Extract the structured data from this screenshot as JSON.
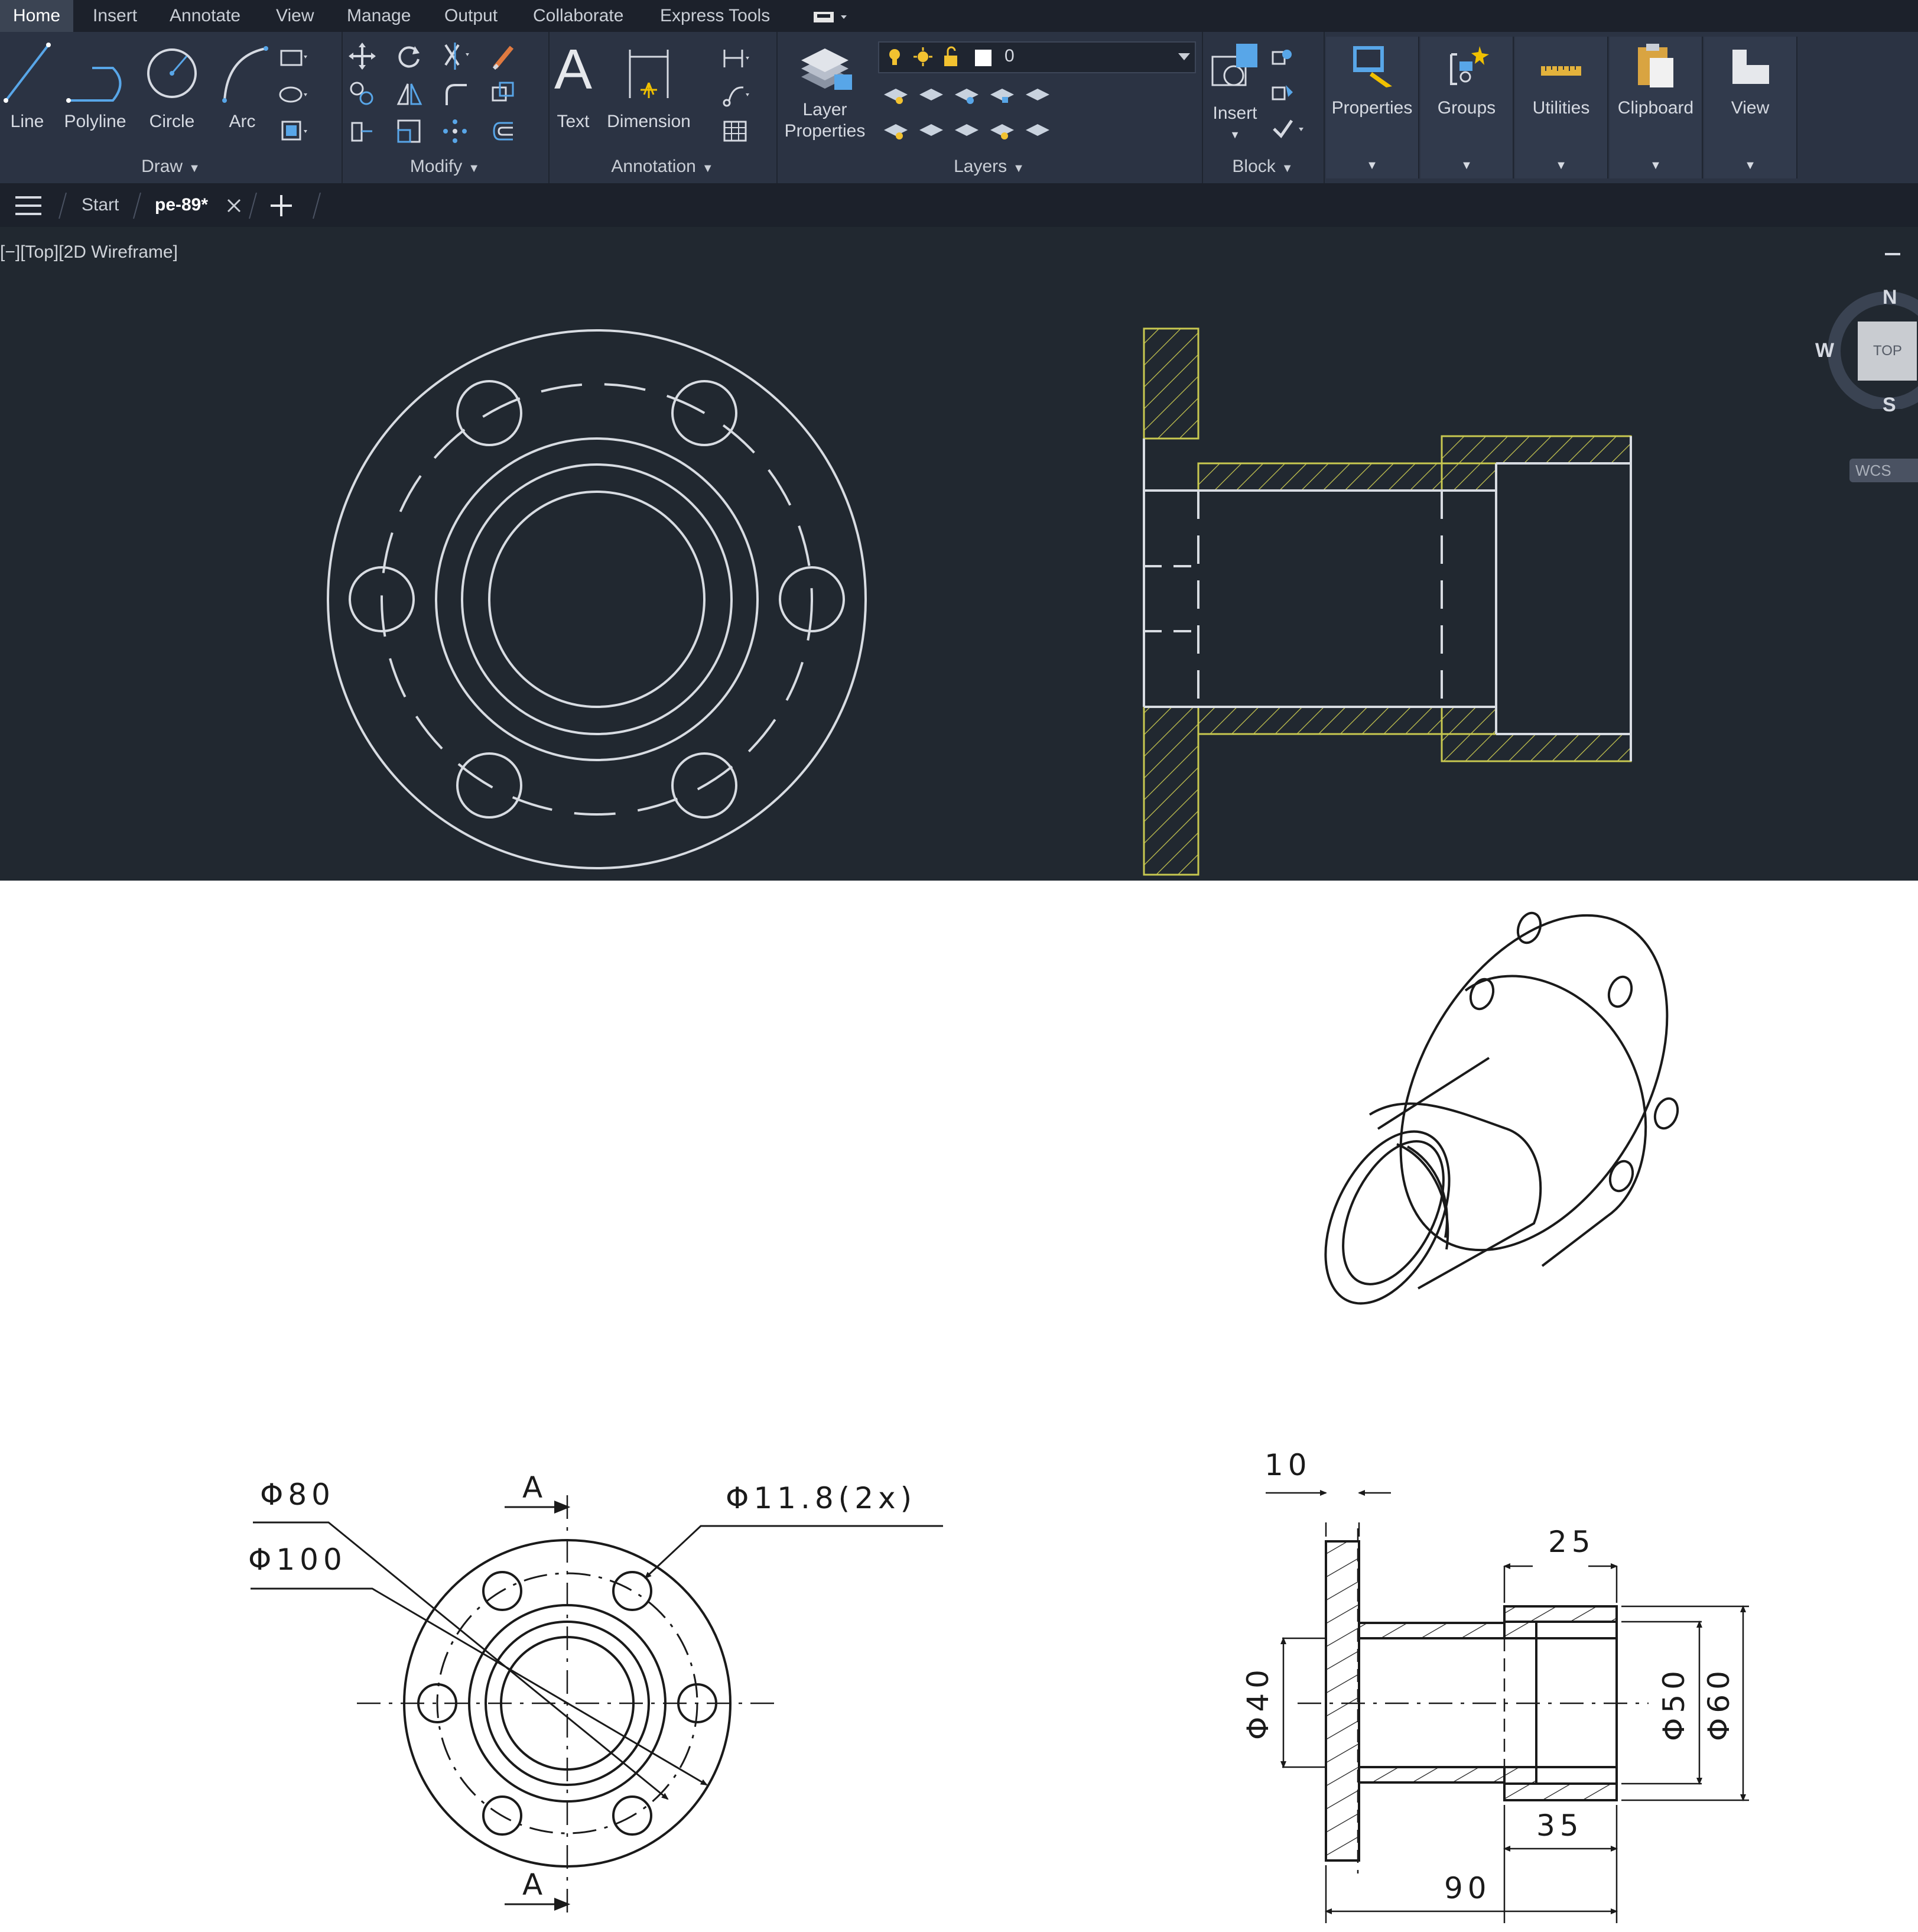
{
  "menu": {
    "tabs": [
      "Home",
      "Insert",
      "Annotate",
      "View",
      "Manage",
      "Output",
      "Collaborate",
      "Express Tools"
    ]
  },
  "ribbon": {
    "draw": {
      "title": "Draw",
      "line": "Line",
      "polyline": "Polyline",
      "circle": "Circle",
      "arc": "Arc"
    },
    "modify": {
      "title": "Modify"
    },
    "annotation": {
      "title": "Annotation",
      "text": "Text",
      "dimension": "Dimension"
    },
    "layers": {
      "title": "Layers",
      "layer_properties_1": "Layer",
      "layer_properties_2": "Properties",
      "current_layer": "0"
    },
    "block": {
      "title": "Block",
      "insert": "Insert"
    },
    "properties": "Properties",
    "groups": "Groups",
    "utilities": "Utilities",
    "clipboard": "Clipboard",
    "view": "View"
  },
  "file_tabs": {
    "start": "Start",
    "active": "pe-89*"
  },
  "viewport": {
    "label": "[−][Top][2D Wireframe]",
    "viewcube": {
      "n": "N",
      "w": "W",
      "s": "S",
      "top": "TOP",
      "wcs": "WCS"
    },
    "colors": {
      "background": "#212830",
      "lines": "#d8dce2",
      "hatch": "#c8c850"
    }
  },
  "drawing": {
    "section_letter": "A",
    "dims": {
      "d80": "Φ80",
      "d100": "Φ100",
      "d11_8": "Φ11.8(2x)",
      "t10": "10",
      "l25": "25",
      "d40": "Φ40",
      "d50": "Φ50",
      "d60": "Φ60",
      "l35": "35",
      "l90": "90"
    }
  }
}
